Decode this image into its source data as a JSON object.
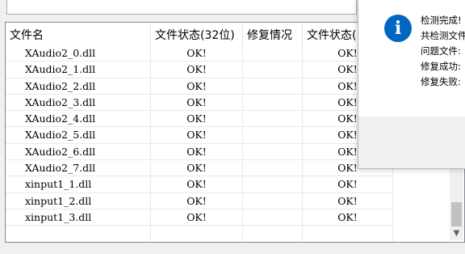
{
  "table": {
    "columns": [
      "文件名",
      "文件状态(32位)",
      "修复情况",
      "文件状态("
    ],
    "rows": [
      {
        "name": "XAudio2_0.dll",
        "s32": "OK!",
        "fix": "",
        "s64": "OK!"
      },
      {
        "name": "XAudio2_1.dll",
        "s32": "OK!",
        "fix": "",
        "s64": "OK!"
      },
      {
        "name": "XAudio2_2.dll",
        "s32": "OK!",
        "fix": "",
        "s64": "OK!"
      },
      {
        "name": "XAudio2_3.dll",
        "s32": "OK!",
        "fix": "",
        "s64": "OK!"
      },
      {
        "name": "XAudio2_4.dll",
        "s32": "OK!",
        "fix": "",
        "s64": "OK!"
      },
      {
        "name": "XAudio2_5.dll",
        "s32": "OK!",
        "fix": "",
        "s64": "OK!"
      },
      {
        "name": "XAudio2_6.dll",
        "s32": "OK!",
        "fix": "",
        "s64": "OK!"
      },
      {
        "name": "XAudio2_7.dll",
        "s32": "OK!",
        "fix": "",
        "s64": "OK!"
      },
      {
        "name": "xinput1_1.dll",
        "s32": "OK!",
        "fix": "",
        "s64": "OK!"
      },
      {
        "name": "xinput1_2.dll",
        "s32": "OK!",
        "fix": "",
        "s64": "OK!"
      },
      {
        "name": "xinput1_3.dll",
        "s32": "OK!",
        "fix": "",
        "s64": "OK!"
      }
    ]
  },
  "dialog": {
    "icon": "info-icon",
    "lines": [
      "检测完成!",
      "共检测文件",
      "问题文件:",
      "修复成功:",
      "修复失败:"
    ]
  },
  "colors": {
    "accent": "#0067c0"
  }
}
